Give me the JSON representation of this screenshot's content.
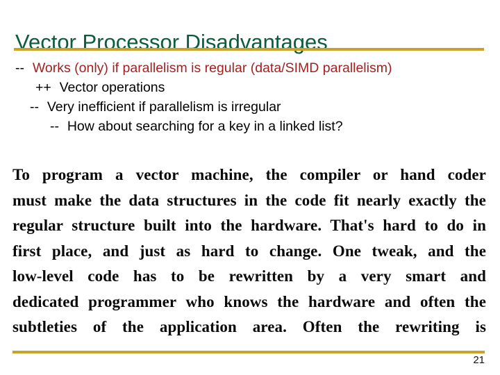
{
  "slide": {
    "title": "Vector Processor Disadvantages",
    "title_color": "#0b5c3b",
    "rule_color": "#c9a227",
    "background_color": "#ffffff",
    "page_number": "21"
  },
  "bullets": [
    {
      "marker": "--",
      "text": "Works (only) if parallelism is regular (data/SIMD parallelism)",
      "level": 0,
      "color": "#a61f1f"
    },
    {
      "marker": "++",
      "text": "Vector operations",
      "level": 1,
      "color": "#000000"
    },
    {
      "marker": "--",
      "text": "Very inefficient if parallelism is irregular",
      "level": 2,
      "color": "#000000"
    },
    {
      "marker": "--",
      "text": "How about searching for a key in a linked list?",
      "level": 3,
      "color": "#000000"
    }
  ],
  "quote": {
    "lines": [
      "To program a vector machine, the compiler or hand coder",
      "must make the data structures in the code fit nearly exactly the",
      "regular structure built into the hardware.  That's hard to do in",
      "first place, and just as hard to change.  One tweak, and the",
      "low-level code has to be rewritten by a very smart and",
      "dedicated programmer who knows the hardware and often the",
      "subtleties of the application area.   Often the rewriting is"
    ]
  }
}
